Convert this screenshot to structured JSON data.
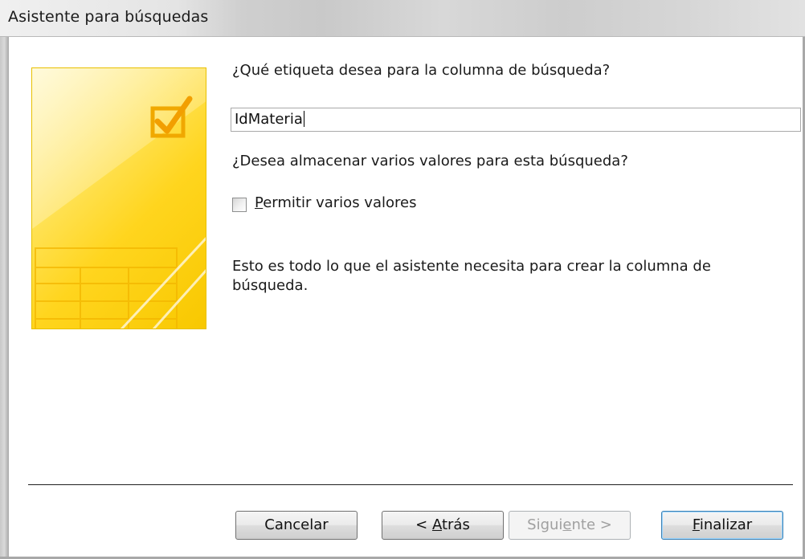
{
  "window": {
    "title": "Asistente para búsquedas"
  },
  "wizard": {
    "label_question": "¿Qué etiqueta desea para la columna de búsqueda?",
    "label_value": "IdMateria",
    "multi_question": "¿Desea almacenar varios valores para esta búsqueda?",
    "multi_checkbox": {
      "label_accel": "P",
      "label_rest": "ermitir varios valores",
      "checked": false
    },
    "info_text": "Esto es todo lo que el asistente necesita para crear la columna de búsqueda."
  },
  "buttons": {
    "cancel": "Cancelar",
    "back_prefix": "< ",
    "back_accel": "A",
    "back_rest": "trás",
    "next_prefix": "Sigui",
    "next_accel": "e",
    "next_rest": "nte >",
    "finish_accel": "F",
    "finish_rest": "inalizar"
  },
  "icons": {
    "art": "wizard-table-checkmark-art",
    "checkbox": "checkbox-unchecked-icon"
  },
  "colors": {
    "art_yellow": "#ffd51e",
    "art_orange": "#f2a300",
    "default_button_border": "#3c7fb1",
    "disabled_text": "#a0a0a0"
  }
}
